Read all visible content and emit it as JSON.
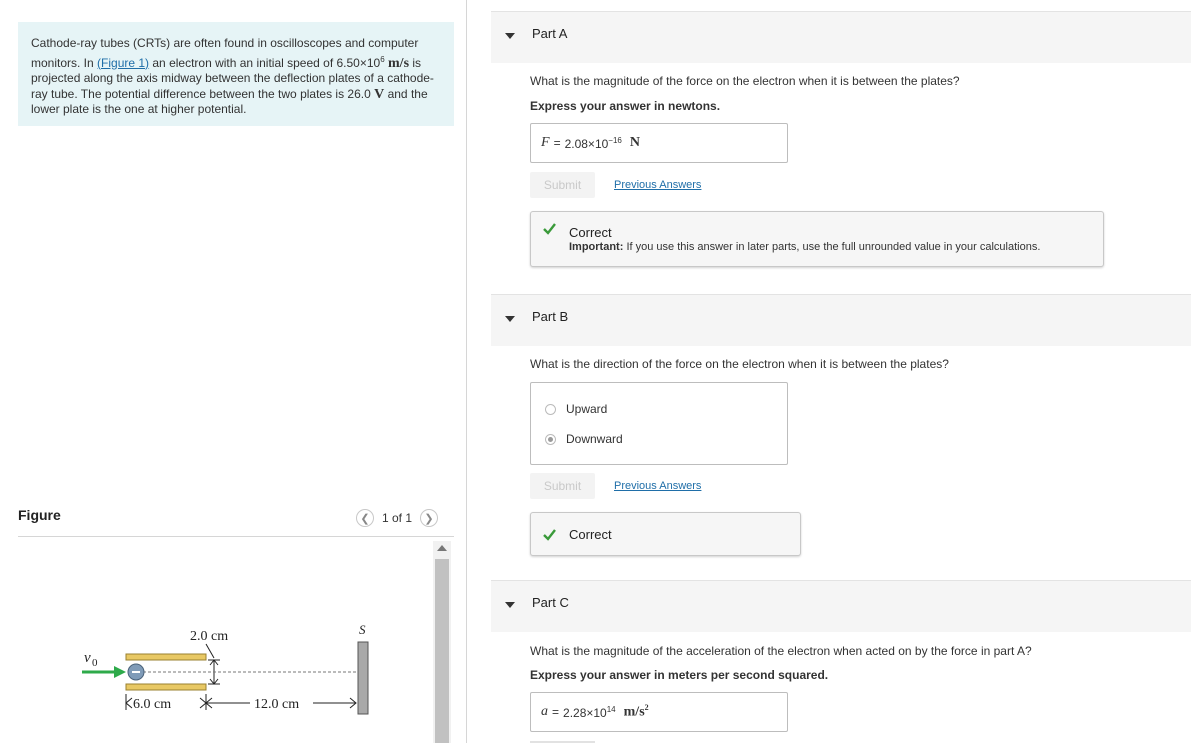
{
  "intro": {
    "line1": "Cathode-ray tubes (CRTs) are often found in oscilloscopes and computer",
    "line2_pre": "monitors. In ",
    "figure_link": "(Figure 1)",
    "line2_mid": " an electron with an initial speed of 6.50×10",
    "speed_exp": "6",
    "speed_unit": "m/s",
    "line2_post": " is",
    "line3": "projected along the axis midway between the deflection plates of a cathode-",
    "line4_pre": "ray tube. The potential difference between the two plates is 26.0 ",
    "volt_unit": "V",
    "line4_post": " and the",
    "line5": "lower plate is the one at higher potential."
  },
  "figure_panel": {
    "title": "Figure",
    "pager_text": "1 of 1",
    "prev_icon": "chevron-left-icon",
    "next_icon": "chevron-right-icon",
    "labels": {
      "v0": "v0",
      "gap": "2.0 cm",
      "screen": "S",
      "plate_len": "6.0 cm",
      "dist": "12.0 cm"
    }
  },
  "partA": {
    "title": "Part A",
    "question": "What is the magnitude of the force on the electron when it is between the plates?",
    "instruction": "Express your answer in newtons.",
    "answer_var": "F",
    "answer_eq": "=",
    "answer_mantissa": "2.08×10",
    "answer_exp": "−16",
    "answer_unit": "N",
    "submit": "Submit",
    "prev_answers": "Previous Answers",
    "feedback_title": "Correct",
    "feedback_important": "Important:",
    "feedback_note": " If you use this answer in later parts, use the full unrounded value in your calculations."
  },
  "partB": {
    "title": "Part B",
    "question": "What is the direction of the force on the electron when it is between the plates?",
    "options": [
      "Upward",
      "Downward"
    ],
    "selected": "Downward",
    "submit": "Submit",
    "prev_answers": "Previous Answers",
    "feedback_title": "Correct"
  },
  "partC": {
    "title": "Part C",
    "question": "What is the magnitude of the acceleration of the electron when acted on by the force in part A?",
    "instruction": "Express your answer in meters per second squared.",
    "answer_var": "a",
    "answer_eq": "=",
    "answer_mantissa": "2.28×10",
    "answer_exp": "14",
    "answer_unit": "m/s",
    "answer_unit_exp": "2"
  },
  "colors": {
    "intro_bg": "#e6f4f6",
    "link": "#1f6ea8",
    "correct_check": "#3a9a3a",
    "arrow_green": "#2eaa4a",
    "plate_fill": "#e8c864"
  }
}
